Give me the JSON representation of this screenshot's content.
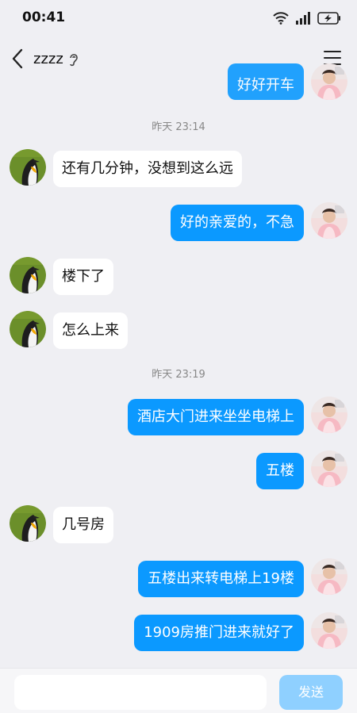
{
  "status_bar": {
    "time": "00:41"
  },
  "header": {
    "title": "zzzz"
  },
  "timestamps": {
    "t1": "昨天 23:14",
    "t2": "昨天 23:19"
  },
  "messages": {
    "m0": "好好开车",
    "m1": "还有几分钟，没想到这么远",
    "m2": "好的亲爱的，不急",
    "m3": "楼下了",
    "m4": "怎么上来",
    "m5": "酒店大门进来坐坐电梯上",
    "m6": "五楼",
    "m7": "几号房",
    "m8": "五楼出来转电梯上19楼",
    "m9": "1909房推门进来就好了"
  },
  "input_bar": {
    "placeholder": "",
    "send_label": "发送"
  },
  "colors": {
    "outgoing_bubble": "#0b99ff",
    "incoming_bubble": "#ffffff",
    "background": "#efeff3",
    "send_button": "#8fd0ff"
  },
  "icons": [
    "wifi-icon",
    "signal-icon",
    "battery-icon",
    "back-icon",
    "ear-icon",
    "menu-icon",
    "penguin-avatar-icon",
    "user-avatar-icon"
  ]
}
